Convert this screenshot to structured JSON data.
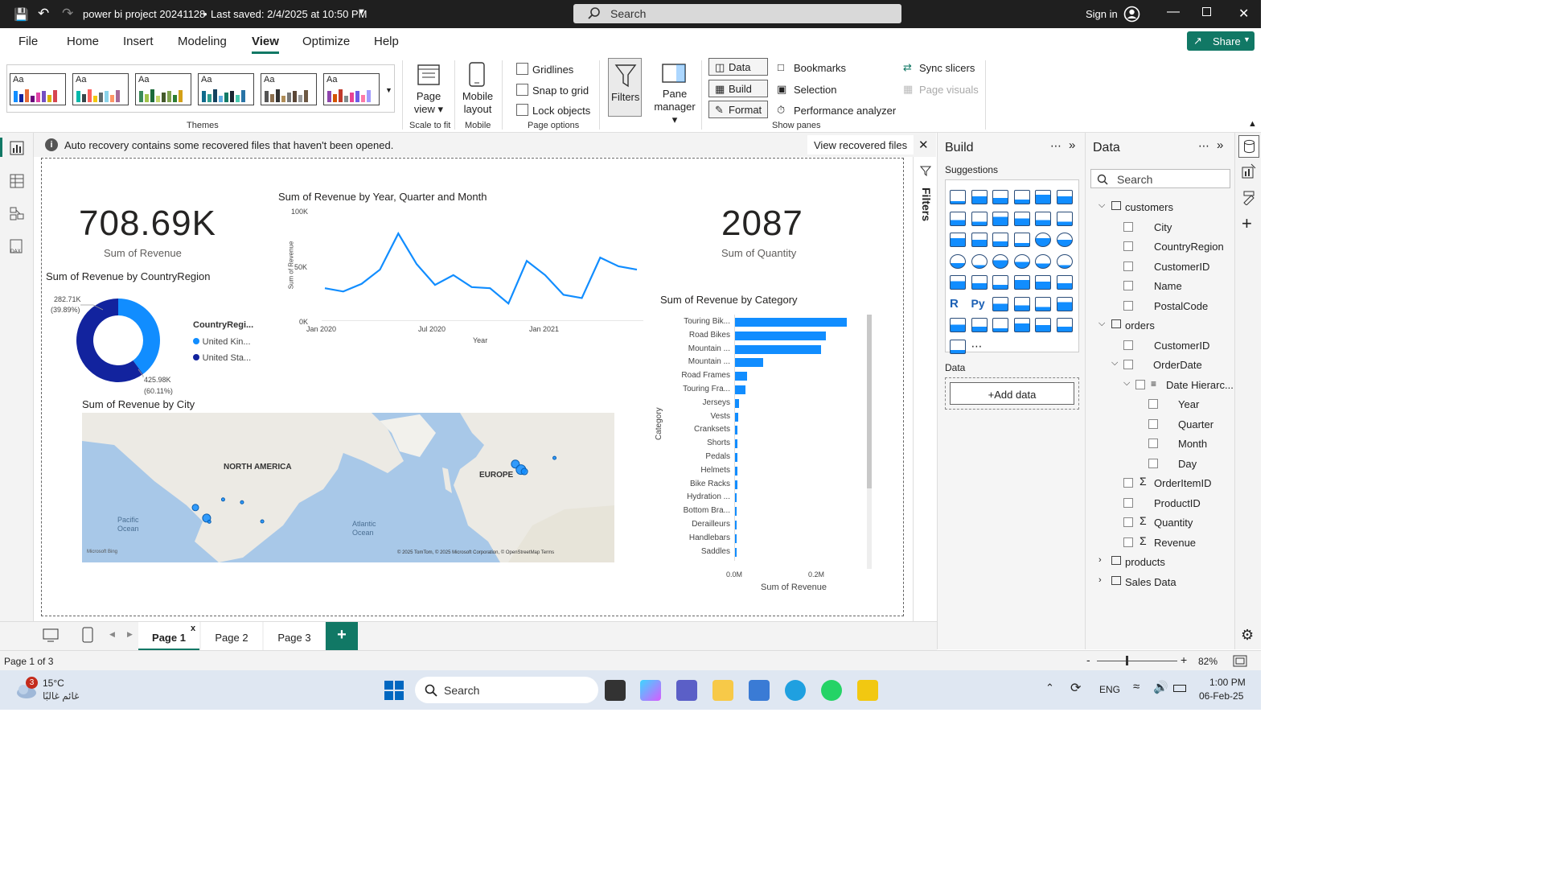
{
  "titlebar": {
    "doc_title": "power bi project 20241128",
    "saved": "Last saved: 2/4/2025 at 10:50 PM",
    "search_placeholder": "Search",
    "sign_in": "Sign in"
  },
  "menu": {
    "items": [
      "File",
      "Home",
      "Insert",
      "Modeling",
      "View",
      "Optimize",
      "Help"
    ],
    "active": "View",
    "share": "Share"
  },
  "ribbon": {
    "theme_label": "Aa",
    "themes_group": "Themes",
    "page_view": "Page view",
    "scale_to_fit": "Scale to fit",
    "mobile_layout": "Mobile layout",
    "mobile_group": "Mobile",
    "gridlines": "Gridlines",
    "snap_to_grid": "Snap to grid",
    "lock_objects": "Lock objects",
    "page_options": "Page options",
    "filters": "Filters",
    "pane_manager": "Pane manager",
    "data": "Data",
    "build": "Build",
    "format": "Format",
    "bookmarks": "Bookmarks",
    "selection": "Selection",
    "performance_analyzer": "Performance analyzer",
    "sync_slicers": "Sync slicers",
    "page_visuals": "Page visuals",
    "show_panes": "Show panes"
  },
  "notice": {
    "text": "Auto recovery contains some recovered files that haven't been opened.",
    "action": "View recovered files"
  },
  "kpis": {
    "revenue_value": "708.69K",
    "revenue_label": "Sum of Revenue",
    "quantity_value": "2087",
    "quantity_label": "Sum of Quantity"
  },
  "donut": {
    "title": "Sum of Revenue by CountryRegion",
    "legend_title": "CountryRegi...",
    "label_a_value": "282.71K",
    "label_a_pct": "(39.89%)",
    "label_b_value": "425.98K",
    "label_b_pct": "(60.11%)"
  },
  "line": {
    "title": "Sum of Revenue by Year, Quarter and Month",
    "xlabel": "Year",
    "ylabel": "Sum of Revenue",
    "y_ticks": [
      "100K",
      "50K",
      "0K"
    ],
    "x_ticks": [
      "Jan 2020",
      "Jul 2020",
      "Jan 2021"
    ]
  },
  "map": {
    "title": "Sum of Revenue by City",
    "north_america": "NORTH AMERICA",
    "europe": "EUROPE",
    "pacific": "Pacific Ocean",
    "atlantic": "Atlantic Ocean",
    "bing": "Microsoft Bing",
    "credits": "© 2025 TomTom, © 2025 Microsoft Corporation, © OpenStreetMap  Terms"
  },
  "bar": {
    "title": "Sum of Revenue by Category",
    "ylabel": "Category",
    "xlabel": "Sum of Revenue",
    "x_ticks": [
      "0.0M",
      "0.2M"
    ]
  },
  "chart_data": [
    {
      "type": "pie",
      "title": "Sum of Revenue by CountryRegion",
      "categories": [
        "United Kin...",
        "United Sta..."
      ],
      "values": [
        282.71,
        425.98
      ],
      "unit": "K",
      "percents": [
        39.89,
        60.11
      ],
      "colors": [
        "#118dff",
        "#12239e"
      ],
      "legend_title": "CountryRegi...",
      "legend": "right"
    },
    {
      "type": "line",
      "title": "Sum of Revenue by Year, Quarter and Month",
      "xlabel": "Year",
      "ylabel": "Sum of Revenue",
      "x": [
        "Jan 2020",
        "Feb 2020",
        "Mar 2020",
        "Apr 2020",
        "May 2020",
        "Jun 2020",
        "Jul 2020",
        "Aug 2020",
        "Sep 2020",
        "Oct 2020",
        "Nov 2020",
        "Dec 2020",
        "Jan 2021",
        "Feb 2021",
        "Mar 2021",
        "Apr 2021",
        "May 2021",
        "Jun 2021",
        "Jul 2021"
      ],
      "series": [
        {
          "values": [
            30000,
            27000,
            34000,
            47000,
            80000,
            52000,
            33000,
            42000,
            31000,
            30000,
            16000,
            55000,
            42000,
            24000,
            21000,
            58000,
            50000,
            47000
          ]
        }
      ],
      "ylim": [
        0,
        100000
      ],
      "color": "#118dff",
      "grid": false
    },
    {
      "type": "bar",
      "orientation": "horizontal",
      "title": "Sum of Revenue by Category",
      "xlabel": "Sum of Revenue",
      "ylabel": "Category",
      "categories": [
        "Touring Bik...",
        "Road Bikes",
        "Mountain ...",
        "Mountain ...",
        "Road Frames",
        "Touring Fra...",
        "Jerseys",
        "Vests",
        "Cranksets",
        "Shorts",
        "Pedals",
        "Helmets",
        "Bike Racks",
        "Hydration ...",
        "Bottom Bra...",
        "Derailleurs",
        "Handlebars",
        "Saddles"
      ],
      "values": [
        0.22,
        0.18,
        0.17,
        0.055,
        0.024,
        0.02,
        0.008,
        0.006,
        0.005,
        0.005,
        0.004,
        0.004,
        0.004,
        0.003,
        0.003,
        0.003,
        0.003,
        0.002
      ],
      "unit": "M",
      "xlim": [
        0,
        0.25
      ],
      "color": "#118dff"
    }
  ],
  "map_points": [
    {
      "lon": -122.4,
      "lat": 37.8,
      "r": 4
    },
    {
      "lon": -118.2,
      "lat": 34.0,
      "r": 5
    },
    {
      "lon": -117.2,
      "lat": 32.7,
      "r": 2
    },
    {
      "lon": -112.0,
      "lat": 40.7,
      "r": 2
    },
    {
      "lon": -104.9,
      "lat": 39.7,
      "r": 2
    },
    {
      "lon": -97.3,
      "lat": 32.8,
      "r": 2
    },
    {
      "lon": -2.2,
      "lat": 53.5,
      "r": 5
    },
    {
      "lon": -0.1,
      "lat": 51.5,
      "r": 6
    },
    {
      "lon": 1.2,
      "lat": 50.8,
      "r": 4
    },
    {
      "lon": 12.5,
      "lat": 55.7,
      "r": 2
    }
  ],
  "build_pane": {
    "title": "Build",
    "suggestions": "Suggestions",
    "data_label": "Data",
    "add_data": "+Add data"
  },
  "data_pane": {
    "title": "Data",
    "search_placeholder": "Search",
    "fields": [
      {
        "label": "customers",
        "type": "table",
        "expanded": true
      },
      {
        "label": "City",
        "type": "field"
      },
      {
        "label": "CountryRegion",
        "type": "field"
      },
      {
        "label": "CustomerID",
        "type": "field"
      },
      {
        "label": "Name",
        "type": "field"
      },
      {
        "label": "PostalCode",
        "type": "field"
      },
      {
        "label": "orders",
        "type": "table",
        "expanded": true
      },
      {
        "label": "CustomerID",
        "type": "field"
      },
      {
        "label": "OrderDate",
        "type": "group"
      },
      {
        "label": "Date Hierarc...",
        "type": "hierarchy"
      },
      {
        "label": "Year",
        "type": "level"
      },
      {
        "label": "Quarter",
        "type": "level"
      },
      {
        "label": "Month",
        "type": "level"
      },
      {
        "label": "Day",
        "type": "level"
      },
      {
        "label": "OrderItemID",
        "type": "measure"
      },
      {
        "label": "ProductID",
        "type": "field"
      },
      {
        "label": "Quantity",
        "type": "measure"
      },
      {
        "label": "Revenue",
        "type": "measure"
      },
      {
        "label": "products",
        "type": "table",
        "expanded": false
      },
      {
        "label": "Sales Data",
        "type": "table",
        "expanded": false
      }
    ]
  },
  "filters_label": "Filters",
  "pages": {
    "tabs": [
      "Page 1",
      "Page 2",
      "Page 3"
    ],
    "active": "Page 1",
    "close": "x",
    "add": "+"
  },
  "statusbar": {
    "page_info": "Page 1 of 3",
    "zoom": "82%",
    "zoom_minus": "-",
    "zoom_plus": "+"
  },
  "taskbar": {
    "weather_temp": "15°C",
    "weather_text": "غائم غالبًا",
    "weather_badge": "3",
    "search": "Search",
    "lang": "ENG",
    "time": "1:00 PM",
    "date": "06-Feb-25"
  }
}
